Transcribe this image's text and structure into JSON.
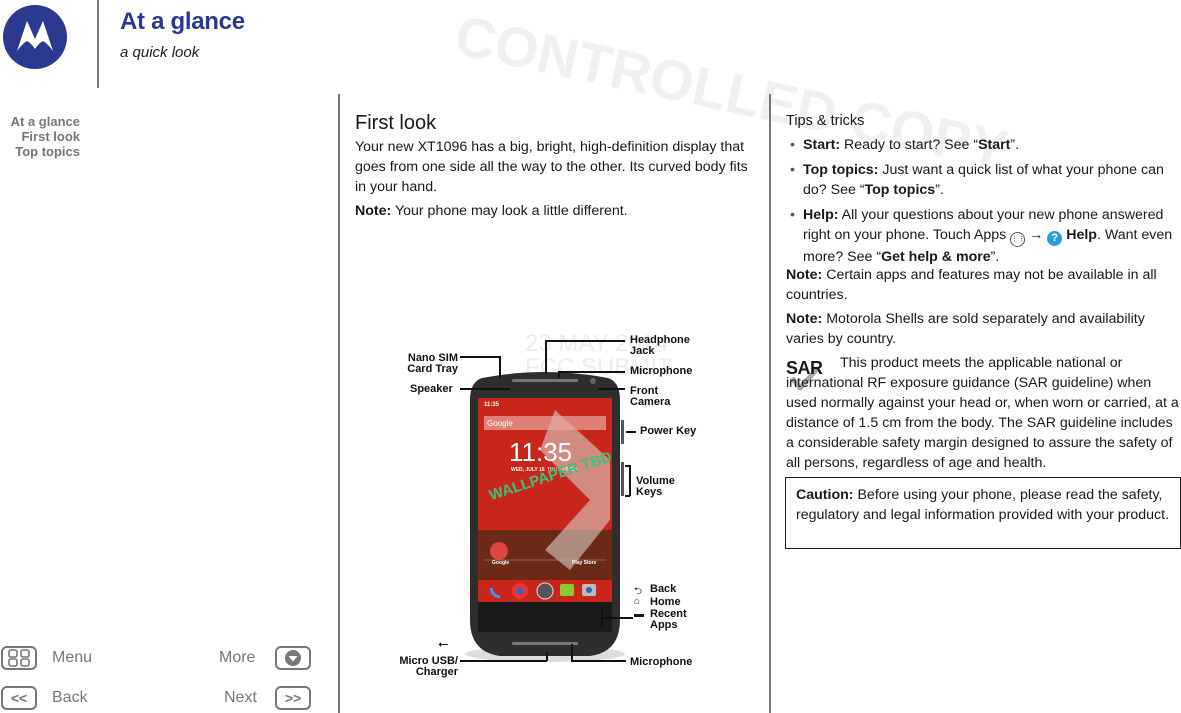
{
  "header": {
    "title": "At a glance",
    "subtitle": "a quick look",
    "brand_color": "#2b3990"
  },
  "toc": {
    "items": [
      {
        "label": "At a glance"
      },
      {
        "label": "First look"
      },
      {
        "label": "Top topics"
      }
    ]
  },
  "bottom_nav": {
    "menu_label": "Menu",
    "more_label": "More",
    "back_label": "Back",
    "next_label": "Next",
    "back_glyph": "<<",
    "next_glyph": ">>"
  },
  "first_look": {
    "heading": "First look",
    "body": "Your new XT1096 has a big, bright, high-definition display that goes from one side all the way to the other. Its curved body fits in your hand.",
    "note_label": "Note:",
    "note_text": " Your phone may look a little different."
  },
  "diagram": {
    "callouts": {
      "nano_sim": "Nano SIM Card Tray",
      "speaker": "Speaker",
      "headphone": "Headphone Jack",
      "microphone_top": "Microphone",
      "front_camera": "Front Camera",
      "power_key": "Power Key",
      "volume_keys": "Volume Keys",
      "back": "Back",
      "home": "Home",
      "recent_apps": "Recent Apps",
      "micro_usb": "Micro USB/ Charger",
      "microphone_bottom": "Microphone"
    },
    "screen": {
      "status_time": "11:35",
      "search_text": "Google",
      "clock": "11:35",
      "date": "WED, JULY 16",
      "alarm": "THU 7:00 AM",
      "wallpaper_text": "WALLPAPER TBD",
      "app_google": "Google",
      "app_play_store": "Play Store"
    },
    "watermark_date": "23 MAY 2014",
    "watermark_submit": "FCC SUBMIT"
  },
  "tips": {
    "heading": "Tips & tricks",
    "items": [
      {
        "label": "Start:",
        "text": " Ready to start? See “",
        "link": "Start",
        "tail": "”."
      },
      {
        "label": "Top topics:",
        "text": " Just want a quick list of what your phone can do? See “",
        "link": "Top topics",
        "tail": "”."
      },
      {
        "label": "Help:",
        "text": " All your questions about your new phone answered right on your phone. Touch Apps ",
        "help_label": "Help",
        "text2": ". Want even more? See “",
        "link": "Get help & more",
        "tail": "”."
      }
    ],
    "note1_label": "Note:",
    "note1_text": " Certain apps and features may not be available in all countries.",
    "note2_label": "Note:",
    "note2_text": " Motorola Shells are sold separately and availability varies by country.",
    "sar_badge": "SAR",
    "sar_text": "This product meets the applicable national or international RF exposure guidance (SAR guideline) when used normally against your head or, when worn or carried, at a distance of 1.5 cm from the body. The SAR guideline includes a considerable safety margin designed to assure the safety of all persons, regardless of age and health.",
    "caution_label": "Caution:",
    "caution_text": " Before using your phone, please read the safety, regulatory and legal information provided with your product."
  }
}
